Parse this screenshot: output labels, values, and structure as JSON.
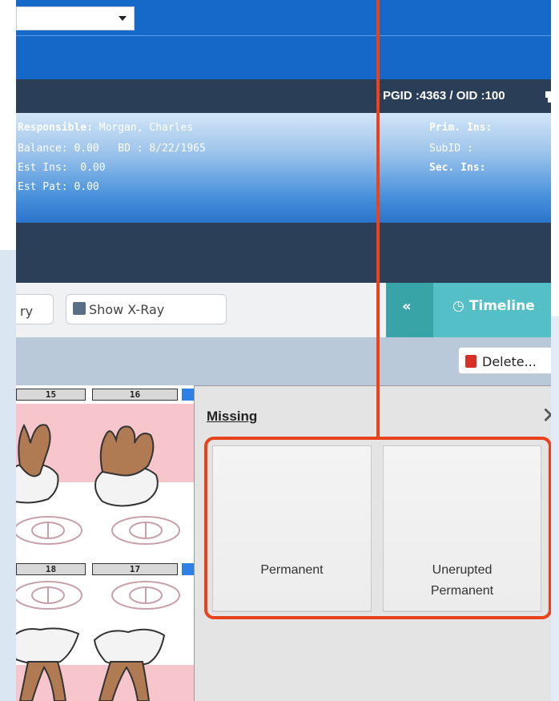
{
  "header": {
    "ids": "PGID :4363  /  OID :100"
  },
  "patient": {
    "responsible_label": "Responsible:",
    "responsible_value": "Morgan, Charles",
    "balance_label": "Balance:",
    "balance_value": "0.00",
    "bd_label": "BD :",
    "bd_value": "8/22/1965",
    "est_ins_label": "Est Ins:",
    "est_ins_value": "0.00",
    "est_pat_label": "Est Pat:",
    "est_pat_value": "0.00",
    "prim_ins_label": "Prim. Ins:",
    "subid_label": "SubID :",
    "sec_ins_label": "Sec. Ins:"
  },
  "toolbar": {
    "left_button_label": "ry",
    "xray_button_label": "Show X-Ray",
    "timeline_chevron": "«",
    "timeline_label": "Timeline",
    "delete_label": "Delete..."
  },
  "chart": {
    "top_teeth": [
      "15",
      "16"
    ],
    "bottom_teeth": [
      "18",
      "17"
    ]
  },
  "dialog": {
    "title": "Missing",
    "close_glyph": "✕",
    "options": [
      "Permanent",
      "Unerupted\nPermanent"
    ]
  },
  "colors": {
    "accent_blue": "#1469c9",
    "navy": "#2c3f59",
    "teal": "#55bfc7",
    "highlight": "#e8431c"
  }
}
